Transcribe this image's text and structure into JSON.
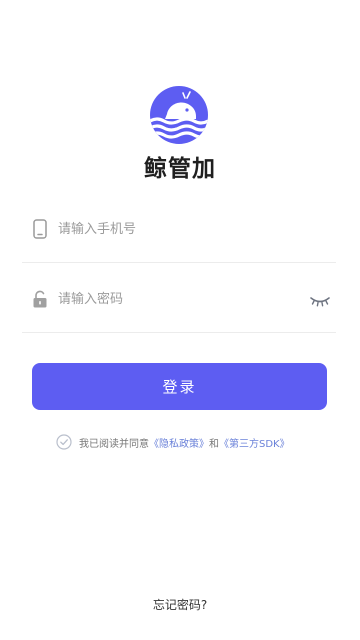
{
  "app": {
    "name": "鲸管加",
    "logo_icon": "whale-wave-logo",
    "brand_color": "#5d5df2"
  },
  "form": {
    "phone": {
      "icon": "phone-icon",
      "placeholder": "请输入手机号",
      "value": ""
    },
    "password": {
      "icon": "lock-icon",
      "placeholder": "请输入密码",
      "value": "",
      "toggle_icon": "eye-closed-icon"
    },
    "login_label": "登录"
  },
  "agreement": {
    "checkbox_icon": "check-circle-icon",
    "prefix": "我已阅读并同意",
    "privacy_link": "《隐私政策》",
    "conjunction": "和",
    "sdk_link": "《第三方SDK》",
    "link_color": "#6b82d9"
  },
  "forgot_password": "忘记密码?"
}
